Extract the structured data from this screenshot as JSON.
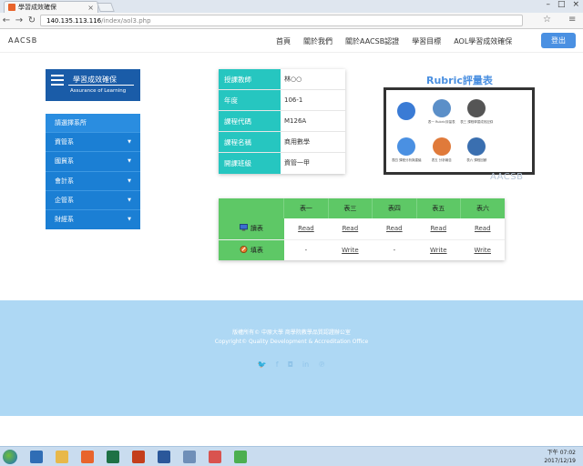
{
  "browser": {
    "tab_title": "學習成效確保",
    "url_host": "140.135.113.116",
    "url_path": "/index/aol3.php"
  },
  "header": {
    "brand": "AACSB",
    "nav": [
      "首頁",
      "關於我們",
      "關於AACSB認證",
      "學習目標",
      "AOL學習成效確保"
    ],
    "logout": "登出"
  },
  "logo": {
    "title": "學習成效確保",
    "subtitle": "Assurance of Learning"
  },
  "sidebar": {
    "items": [
      {
        "label": "請選擇系所"
      },
      {
        "label": "資管系"
      },
      {
        "label": "國貿系"
      },
      {
        "label": "會計系"
      },
      {
        "label": "企管系"
      },
      {
        "label": "財經系"
      }
    ]
  },
  "info": {
    "rows": [
      {
        "key": "授課教師",
        "value": "林○○"
      },
      {
        "key": "年度",
        "value": "106-1"
      },
      {
        "key": "課程代碼",
        "value": "M126A"
      },
      {
        "key": "課程名稱",
        "value": "商用數學"
      },
      {
        "key": "開課班級",
        "value": "資管一甲"
      }
    ]
  },
  "rubric": {
    "title": "Rubric評量表",
    "watermark": "AACSB",
    "cells": [
      {
        "label": "",
        "color": "#3a7bd5"
      },
      {
        "label": "表一 Rubric評量表",
        "color": "#5b8fc8"
      },
      {
        "label": "表三 課程學習成效記錄",
        "color": "#555555"
      },
      {
        "label": "",
        "color": "#ffffff"
      },
      {
        "label": "表四 課程分析與建議",
        "color": "#4a90e2"
      },
      {
        "label": "表五 分析報告",
        "color": "#e07a3a"
      },
      {
        "label": "表六 課程回饋",
        "color": "#3a6fb0"
      },
      {
        "label": "",
        "color": "#ffffff"
      }
    ]
  },
  "actions": {
    "columns": [
      "表一",
      "表三",
      "表四",
      "表五",
      "表六"
    ],
    "rows": [
      {
        "label": "讀表",
        "cells": [
          "Read",
          "Read",
          "Read",
          "Read",
          "Read"
        ]
      },
      {
        "label": "填表",
        "cells": [
          "-",
          "Write",
          "-",
          "Write",
          "Write"
        ]
      }
    ]
  },
  "footer": {
    "line1": "版權所有© 中原大學 商學院教學品質認證辦公室",
    "line2": "Copyright© Quality Development & Accreditation Office",
    "social": [
      "twitter-icon",
      "facebook-icon",
      "instagram-icon",
      "linkedin-icon",
      "pinterest-icon"
    ]
  },
  "taskbar": {
    "time": "下午 07:02",
    "date": "2017/12/19",
    "apps": [
      {
        "name": "media-player",
        "color": "#2f6db5"
      },
      {
        "name": "file-explorer",
        "color": "#e8b84a"
      },
      {
        "name": "firefox",
        "color": "#e8642c"
      },
      {
        "name": "excel",
        "color": "#1e7145"
      },
      {
        "name": "powerpoint",
        "color": "#c43e1c"
      },
      {
        "name": "word",
        "color": "#2b579a"
      },
      {
        "name": "network-tool",
        "color": "#6f8fb8"
      },
      {
        "name": "snipping-tool",
        "color": "#d9534f"
      },
      {
        "name": "chrome",
        "color": "#4caf50"
      }
    ]
  }
}
